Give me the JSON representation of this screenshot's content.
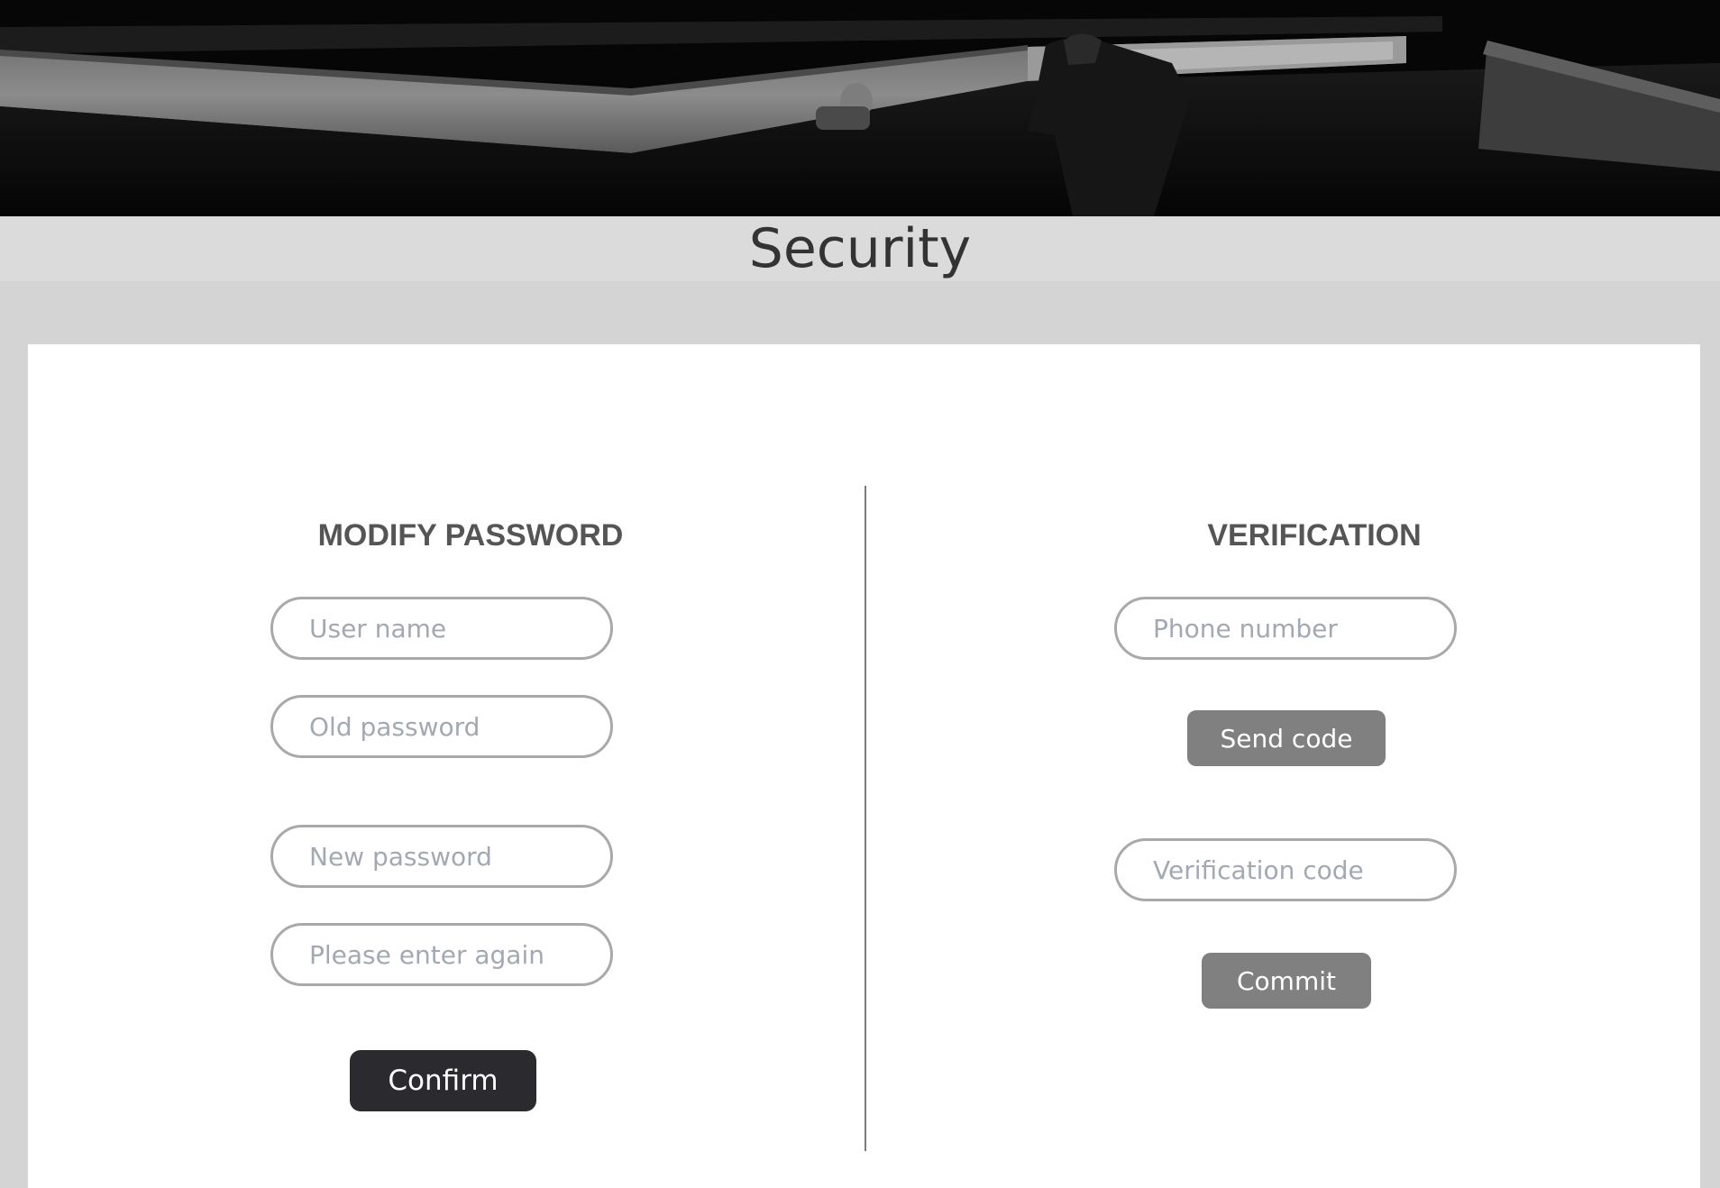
{
  "page": {
    "title": "Security"
  },
  "banner": {
    "image_description_icon": "banner-photo"
  },
  "modify_password": {
    "heading": "MODIFY PASSWORD",
    "user_name_placeholder": "User name",
    "old_password_placeholder": "Old password",
    "new_password_placeholder": "New password",
    "confirm_password_placeholder": "Please enter again",
    "confirm_label": "Confirm"
  },
  "verification": {
    "heading": "VERIFICATION",
    "phone_placeholder": "Phone number",
    "send_code_label": "Send code",
    "code_placeholder": "Verification code",
    "commit_label": "Commit"
  },
  "colors": {
    "page_background": "#d4d4d4",
    "title_bar": "#dbdbdb",
    "card": "#ffffff",
    "confirm_button": "#2b2a2e",
    "secondary_button": "#808080",
    "field_border": "#a9a9a9",
    "placeholder_text": "#a2a9b3"
  }
}
